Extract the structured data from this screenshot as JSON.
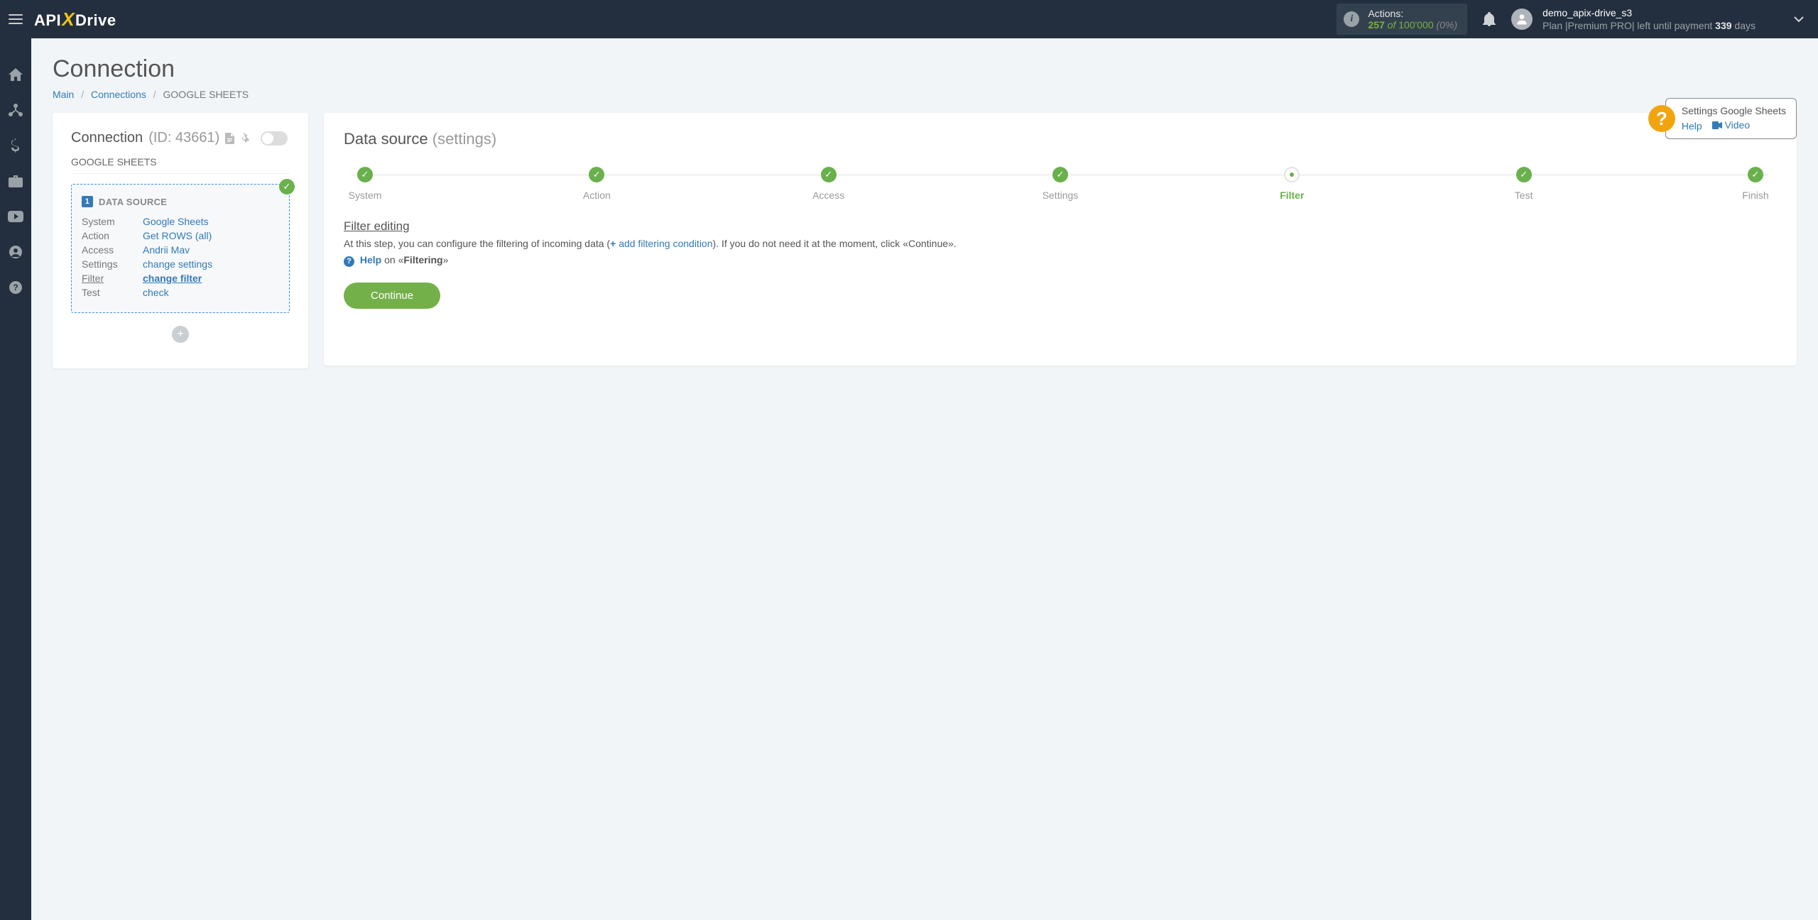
{
  "header": {
    "logo": {
      "pre": "API",
      "x": "X",
      "post": "Drive"
    },
    "actions_box": {
      "label": "Actions:",
      "count": "257",
      "of": "of",
      "limit": "100'000",
      "pct": "(0%)"
    },
    "user": {
      "name": "demo_apix-drive_s3",
      "plan_prefix": "Plan ",
      "plan_sep1": "|",
      "plan_name": "Premium PRO",
      "plan_sep2": "|",
      "remaining_prefix": " left until payment ",
      "remaining_days": "339",
      "remaining_suffix": " days"
    }
  },
  "page": {
    "title": "Connection",
    "breadcrumbs": {
      "main": "Main",
      "connections": "Connections",
      "current": "GOOGLE SHEETS"
    }
  },
  "help_balloon": {
    "title": "Settings Google Sheets",
    "help": "Help",
    "video": "Video"
  },
  "connection_card": {
    "title": "Connection",
    "id_label": "(ID: 43661)",
    "subtitle": "GOOGLE SHEETS",
    "ds_badge": "1",
    "ds_header": "DATA SOURCE",
    "rows": {
      "system": {
        "k": "System",
        "v": "Google Sheets"
      },
      "action": {
        "k": "Action",
        "v": "Get ROWS (all)"
      },
      "access": {
        "k": "Access",
        "v": "Andrii Mav"
      },
      "settings": {
        "k": "Settings",
        "v": "change settings"
      },
      "filter": {
        "k": "Filter",
        "v": "change filter"
      },
      "test": {
        "k": "Test",
        "v": "check"
      }
    }
  },
  "main_card": {
    "title": "Data source",
    "subtitle": "(settings)",
    "steps": [
      "System",
      "Action",
      "Access",
      "Settings",
      "Filter",
      "Test",
      "Finish"
    ],
    "current_step_index": 4,
    "section_header": "Filter editing",
    "section_text_pre": "At this step, you can configure the filtering of incoming data (",
    "add_cond_link": "add filtering condition",
    "section_text_post": "). If you do not need it at the moment, click «Continue».",
    "help_link": "Help",
    "help_on": " on «",
    "help_topic": "Filtering",
    "help_close": "»",
    "continue": "Continue"
  }
}
